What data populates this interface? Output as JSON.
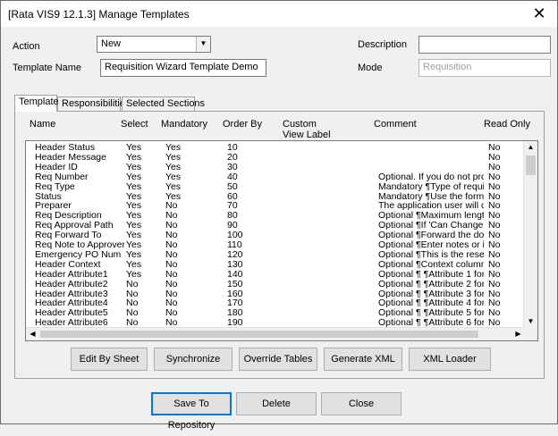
{
  "window": {
    "title": "[Rata VIS9 12.1.3] Manage Templates",
    "close_glyph": "✕"
  },
  "form": {
    "action_label": "Action",
    "action_value": "New",
    "template_name_label": "Template Name",
    "template_name_value": "Requisition Wizard Template Demo",
    "description_label": "Description",
    "description_value": "",
    "mode_label": "Mode",
    "mode_value": "Requisition"
  },
  "tabs": [
    {
      "label": "Template",
      "active": true
    },
    {
      "label": "Responsibilities",
      "active": false
    },
    {
      "label": "Selected Sections",
      "active": false
    }
  ],
  "columns": {
    "name": "Name",
    "select": "Select",
    "mandatory": "Mandatory",
    "order_by": "Order By",
    "custom_view_label_1": "Custom",
    "custom_view_label_2": "View Label",
    "comment": "Comment",
    "read_only": "Read Only"
  },
  "rows": [
    {
      "name": "Header Status",
      "select": "Yes",
      "mandatory": "Yes",
      "order": "10",
      "comment": "",
      "read_only": "No"
    },
    {
      "name": "Header Message",
      "select": "Yes",
      "mandatory": "Yes",
      "order": "20",
      "comment": "",
      "read_only": "No"
    },
    {
      "name": "Header ID",
      "select": "Yes",
      "mandatory": "Yes",
      "order": "30",
      "comment": "",
      "read_only": "No"
    },
    {
      "name": "Req Number",
      "select": "Yes",
      "mandatory": "Yes",
      "order": "40",
      "comment": "Optional.  If you do not prov",
      "read_only": "No"
    },
    {
      "name": "Req Type",
      "select": "Yes",
      "mandatory": "Yes",
      "order": "50",
      "comment": "Mandatory ¶Type of requisiti",
      "read_only": "No"
    },
    {
      "name": "Status",
      "select": "Yes",
      "mandatory": "Yes",
      "order": "60",
      "comment": "Mandatory ¶Use the form to",
      "read_only": "No"
    },
    {
      "name": "Preparer",
      "select": "Yes",
      "mandatory": "No",
      "order": "70",
      "comment": "The application user will defa",
      "read_only": "No"
    },
    {
      "name": "Req Description",
      "select": "Yes",
      "mandatory": "No",
      "order": "80",
      "comment": "Optional  ¶Maximum length is",
      "read_only": "No"
    },
    {
      "name": "Req Approval Path",
      "select": "Yes",
      "mandatory": "No",
      "order": "90",
      "comment": "Optional  ¶If 'Can Change to",
      "read_only": "No"
    },
    {
      "name": "Req Forward To",
      "select": "Yes",
      "mandatory": "No",
      "order": "100",
      "comment": "Optional  ¶Forward the docu",
      "read_only": "No"
    },
    {
      "name": "Req Note to Approver",
      "select": "Yes",
      "mandatory": "No",
      "order": "110",
      "comment": "Optional  ¶Enter notes or inst",
      "read_only": "No"
    },
    {
      "name": "Emergency PO Num",
      "select": "Yes",
      "mandatory": "No",
      "order": "120",
      "comment": "Optional  ¶This is the reserve",
      "read_only": "No"
    },
    {
      "name": "Header Context",
      "select": "Yes",
      "mandatory": "No",
      "order": "130",
      "comment": "Optional  ¶Context  column",
      "read_only": "No"
    },
    {
      "name": "Header Attribute1",
      "select": "Yes",
      "mandatory": "No",
      "order": "140",
      "comment": "Optional  ¶ ¶Attribute 1 for t",
      "read_only": "No"
    },
    {
      "name": "Header Attribute2",
      "select": "No",
      "mandatory": "No",
      "order": "150",
      "comment": "Optional  ¶ ¶Attribute 2 for t",
      "read_only": "No"
    },
    {
      "name": "Header Attribute3",
      "select": "No",
      "mandatory": "No",
      "order": "160",
      "comment": "Optional  ¶ ¶Attribute 3 for t",
      "read_only": "No"
    },
    {
      "name": "Header Attribute4",
      "select": "No",
      "mandatory": "No",
      "order": "170",
      "comment": "Optional  ¶ ¶Attribute 4 for t",
      "read_only": "No"
    },
    {
      "name": "Header Attribute5",
      "select": "No",
      "mandatory": "No",
      "order": "180",
      "comment": "Optional  ¶ ¶Attribute 5 for t",
      "read_only": "No"
    },
    {
      "name": "Header Attribute6",
      "select": "No",
      "mandatory": "No",
      "order": "190",
      "comment": "Optional  ¶ ¶Attribute 6 for t",
      "read_only": "No"
    }
  ],
  "panel_buttons": {
    "edit_by_sheet": "Edit By Sheet",
    "synchronize": "Synchronize",
    "override_tables": "Override Tables",
    "generate_xml": "Generate XML",
    "xml_loader": "XML Loader"
  },
  "bottom_buttons": {
    "save_to_repository": "Save To Repository",
    "delete": "Delete",
    "close": "Close"
  },
  "icons": {
    "dropdown": "▼",
    "scroll_up": "▲",
    "scroll_down": "▼",
    "scroll_left": "◀",
    "scroll_right": "▶"
  }
}
